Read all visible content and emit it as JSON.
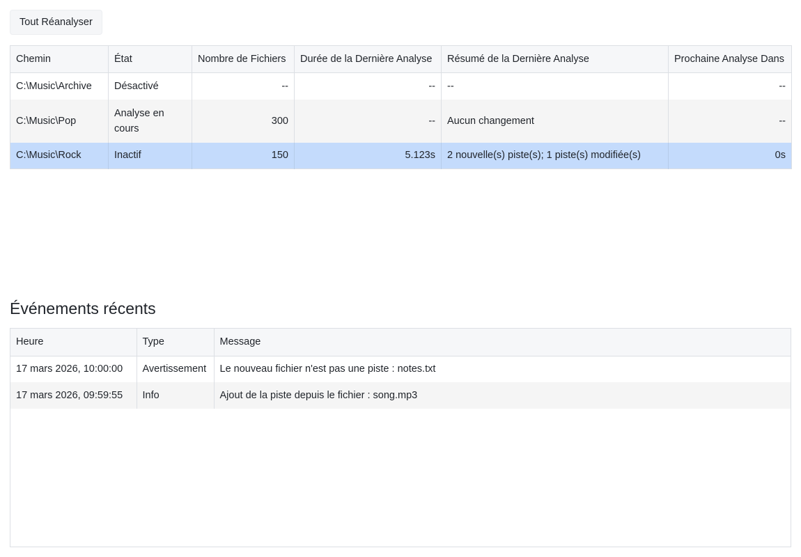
{
  "toolbar": {
    "rescan_all_label": "Tout Réanalyser"
  },
  "folders": {
    "columns": {
      "path": "Chemin",
      "state": "État",
      "file_count": "Nombre de Fichiers",
      "last_duration": "Durée de la Dernière Analyse",
      "last_summary": "Résumé de la Dernière Analyse",
      "next_scan": "Prochaine Analyse Dans"
    },
    "rows": [
      {
        "path": "C:\\Music\\Archive",
        "state": "Désactivé",
        "file_count": "--",
        "last_duration": "--",
        "last_summary": "--",
        "next_scan": "--"
      },
      {
        "path": "C:\\Music\\Pop",
        "state": "Analyse en cours",
        "file_count": "300",
        "last_duration": "--",
        "last_summary": "Aucun changement",
        "next_scan": "--"
      },
      {
        "path": "C:\\Music\\Rock",
        "state": "Inactif",
        "file_count": "150",
        "last_duration": "5.123s",
        "last_summary": "2 nouvelle(s) piste(s); 1 piste(s) modifiée(s)",
        "next_scan": "0s"
      }
    ]
  },
  "events": {
    "title": "Événements récents",
    "columns": {
      "time": "Heure",
      "type": "Type",
      "message": "Message"
    },
    "rows": [
      {
        "time": "17 mars 2026, 10:00:00",
        "type": "Avertissement",
        "message": "Le nouveau fichier n'est pas une piste : notes.txt"
      },
      {
        "time": "17 mars 2026, 09:59:55",
        "type": "Info",
        "message": "Ajout de la piste depuis le fichier : song.mp3"
      }
    ]
  },
  "colors": {
    "selected_row": "#c4dbfc",
    "header_bg": "#f6f7f9",
    "alt_row": "#f5f5f5",
    "border": "#dcdfe4"
  }
}
